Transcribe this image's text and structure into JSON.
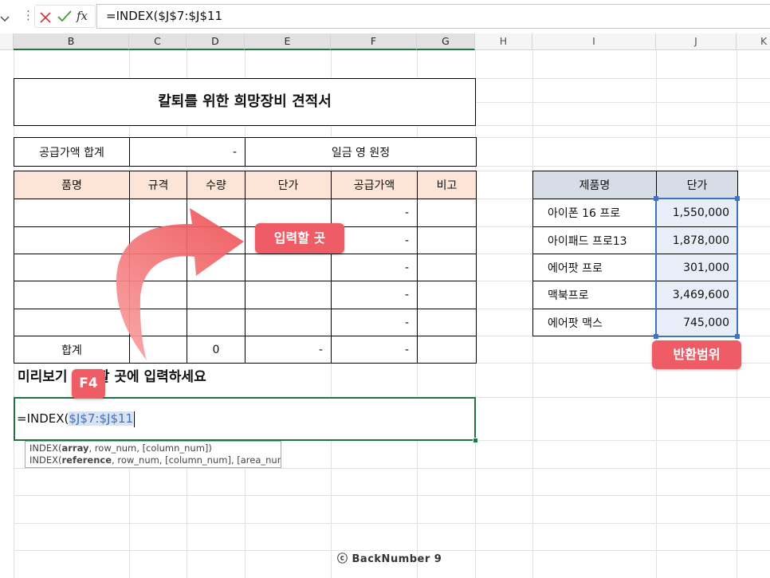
{
  "formula_bar": {
    "name_box_icon": "chevron-down-icon",
    "more_icon": "vertical-ellipsis-icon",
    "dots_glyph": "⋮",
    "cancel_icon": "close-icon",
    "enter_icon": "check-icon",
    "fx_label": "fx",
    "formula": "=INDEX($J$7:$J$11"
  },
  "columns": [
    "B",
    "C",
    "D",
    "E",
    "F",
    "G",
    "H",
    "I",
    "J",
    "K"
  ],
  "quote": {
    "title": "칼퇴를 위한 희망장비 견적서",
    "summary": {
      "label": "공급가액 합계",
      "value": "-",
      "amount_text": "일금 영 원정"
    },
    "headers": [
      "품명",
      "규격",
      "수량",
      "단가",
      "공급가액",
      "비고"
    ],
    "rows": [
      [
        "",
        "",
        "",
        "",
        "-",
        ""
      ],
      [
        "",
        "",
        "",
        "",
        "-",
        ""
      ],
      [
        "",
        "",
        "",
        "",
        "-",
        ""
      ],
      [
        "",
        "",
        "",
        "",
        "-",
        ""
      ],
      [
        "",
        "",
        "",
        "",
        "-",
        ""
      ]
    ],
    "total_row": [
      "합계",
      "",
      "0",
      "-",
      "-",
      ""
    ]
  },
  "instruction": "미리보기 입력할 곳에 입력하세요",
  "input_cell": {
    "prefix": "=INDEX(",
    "range_ref": "$J$7:$J$11"
  },
  "tooltip": [
    {
      "fn": "INDEX(",
      "bold_arg": "array",
      "rest": ", row_num, [column_num])"
    },
    {
      "fn": "INDEX(",
      "bold_arg": "reference",
      "rest": ", row_num, [column_num], [area_num])"
    }
  ],
  "price_table": {
    "headers": [
      "제품명",
      "단가"
    ],
    "rows": [
      [
        "아이폰 16 프로",
        "1,550,000"
      ],
      [
        "아이패드 프로13",
        "1,878,000"
      ],
      [
        "에어팟 프로",
        "301,000"
      ],
      [
        "맥북프로",
        "3,469,600"
      ],
      [
        "에어팟 맥스",
        "745,000"
      ]
    ]
  },
  "annotations": {
    "input_location": "입력할 곳",
    "shortcut_key": "F4",
    "return_range": "반환범위",
    "arrow_icon": "curved-arrow-icon"
  },
  "watermark": "ⓒ BackNumber 9",
  "colors": {
    "accent": "#ee5d66",
    "quote_header_fill": "#fce4d6",
    "price_header_fill": "#d6dde6",
    "range_fill": "#e8eef7",
    "range_border": "#3f72c4",
    "selection_green": "#217346",
    "range_text": "#3b6fd0"
  }
}
